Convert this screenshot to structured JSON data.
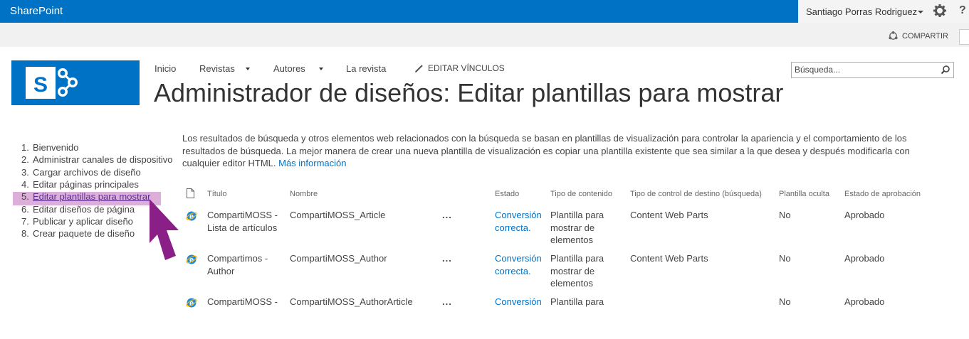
{
  "suitebar": {
    "brand": "SharePoint",
    "user": "Santiago Porras Rodriguez",
    "help": "?",
    "accent": "#0072c6"
  },
  "ribbon": {
    "share_label": "COMPARTIR"
  },
  "topnav": {
    "items": [
      {
        "label": "Inicio"
      },
      {
        "label": "Revistas"
      },
      {
        "label": "Autores"
      },
      {
        "label": "La revista"
      }
    ],
    "edit_links": "EDITAR VÍNCULOS"
  },
  "search": {
    "placeholder": "Búsqueda..."
  },
  "page_title": "Administrador de diseños: Editar plantillas para mostrar",
  "steps": [
    {
      "num": "1.",
      "label": "Bienvenido"
    },
    {
      "num": "2.",
      "label": "Administrar canales de dispositivo"
    },
    {
      "num": "3.",
      "label": "Cargar archivos de diseño"
    },
    {
      "num": "4.",
      "label": "Editar páginas principales"
    },
    {
      "num": "5.",
      "label": "Editar plantillas para mostrar"
    },
    {
      "num": "6.",
      "label": "Editar diseños de página"
    },
    {
      "num": "7.",
      "label": "Publicar y aplicar diseño"
    },
    {
      "num": "8.",
      "label": "Crear paquete de diseño"
    }
  ],
  "description": {
    "text": "Los resultados de búsqueda y otros elementos web relacionados con la búsqueda se basan en plantillas de visualización para controlar la apariencia y el comportamiento de los resultados de búsqueda. La mejor manera de crear una nueva plantilla de visualización es copiar una plantilla existente que sea similar a la que desea y después modificarla con cualquier editor HTML.",
    "link": "Más información"
  },
  "table": {
    "headers": {
      "title": "Título",
      "name": "Nombre",
      "status": "Estado",
      "content_type": "Tipo de contenido",
      "target_control": "Tipo de control de destino (búsqueda)",
      "hidden": "Plantilla oculta",
      "approval": "Estado de aprobación"
    },
    "rows": [
      {
        "title": "CompartiMOSS - Lista de artículos",
        "name": "CompartiMOSS_Article",
        "menu": "...",
        "status": "Conversión correcta.",
        "content_type": "Plantilla para mostrar de elementos",
        "target_control": "Content Web Parts",
        "hidden": "No",
        "approval": "Aprobado"
      },
      {
        "title": "Compartimos - Author",
        "name": "CompartiMOSS_Author",
        "menu": "...",
        "status": "Conversión correcta.",
        "content_type": "Plantilla para mostrar de elementos",
        "target_control": "Content Web Parts",
        "hidden": "No",
        "approval": "Aprobado"
      },
      {
        "title": "CompartiMOSS - ",
        "name": "CompartiMOSS_AuthorArticle",
        "menu": "...",
        "status": "Conversión",
        "content_type": "Plantilla para",
        "target_control": "",
        "hidden": "No",
        "approval": "Aprobado"
      }
    ]
  }
}
